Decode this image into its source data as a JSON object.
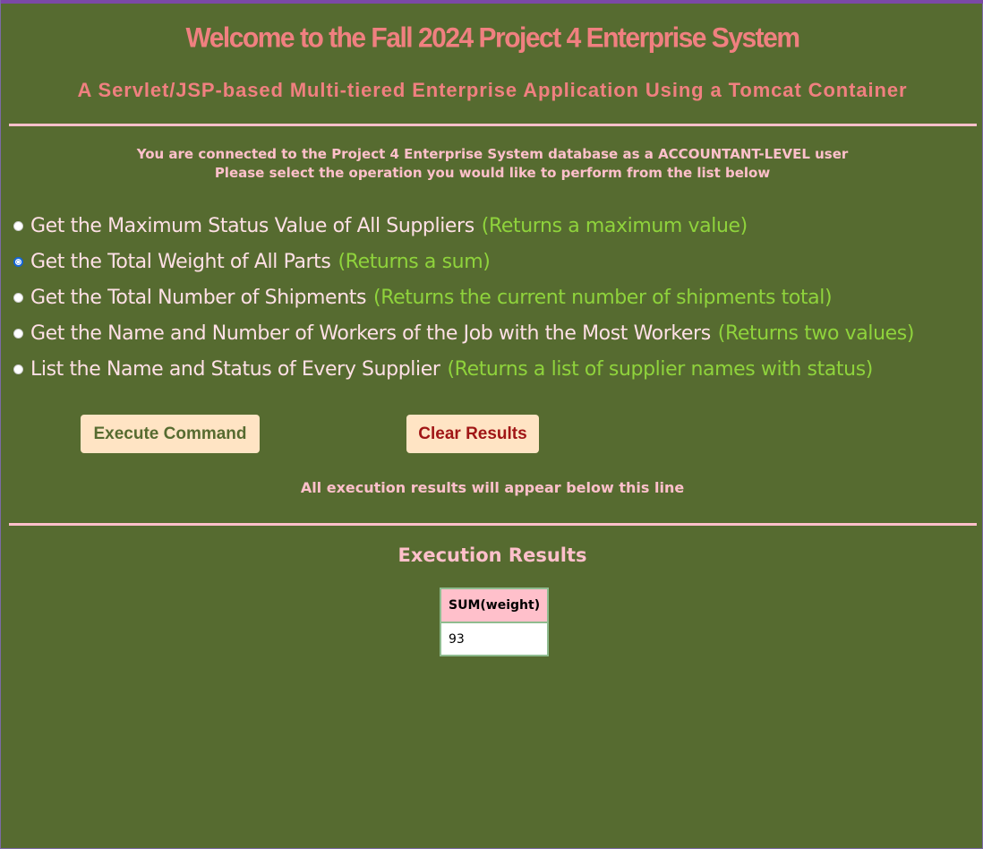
{
  "colors": {
    "background": "#566b30",
    "title": "#f08080",
    "text_pink": "#ffc0cb",
    "option_text": "#ffe0e6",
    "option_note": "#8fd33c",
    "button_bg": "#ffe4c4",
    "execute_text": "#566b30",
    "clear_text": "#a01616",
    "table_header_bg": "#ffc0cb",
    "table_border": "#8fbc8f",
    "top_border": "#7b49a6"
  },
  "header": {
    "title": "Welcome to the Fall 2024 Project 4 Enterprise System",
    "subtitle": "A Servlet/JSP-based Multi-tiered Enterprise Application Using a Tomcat Container"
  },
  "connection": {
    "line1": "You are connected to the Project 4 Enterprise System database as a ACCOUNTANT-LEVEL user",
    "line2": "Please select the operation you would like to perform from the list below"
  },
  "options": [
    {
      "label": "Get the Maximum Status Value of All Suppliers",
      "note": "(Returns a maximum value)",
      "selected": false
    },
    {
      "label": "Get the Total Weight of All Parts",
      "note": "(Returns a sum)",
      "selected": true
    },
    {
      "label": "Get the Total Number of Shipments",
      "note": "(Returns the current number of shipments total)",
      "selected": false
    },
    {
      "label": "Get the Name and Number of Workers of the Job with the Most Workers",
      "note": "(Returns two values)",
      "selected": false
    },
    {
      "label": "List the Name and Status of Every Supplier",
      "note": "(Returns a list of supplier names with status)",
      "selected": false
    }
  ],
  "buttons": {
    "execute_label": "Execute Command",
    "clear_label": "Clear Results"
  },
  "results": {
    "note": "All execution results will appear below this line",
    "heading": "Execution Results",
    "columns": [
      "SUM(weight)"
    ],
    "rows": [
      [
        "93"
      ]
    ]
  }
}
